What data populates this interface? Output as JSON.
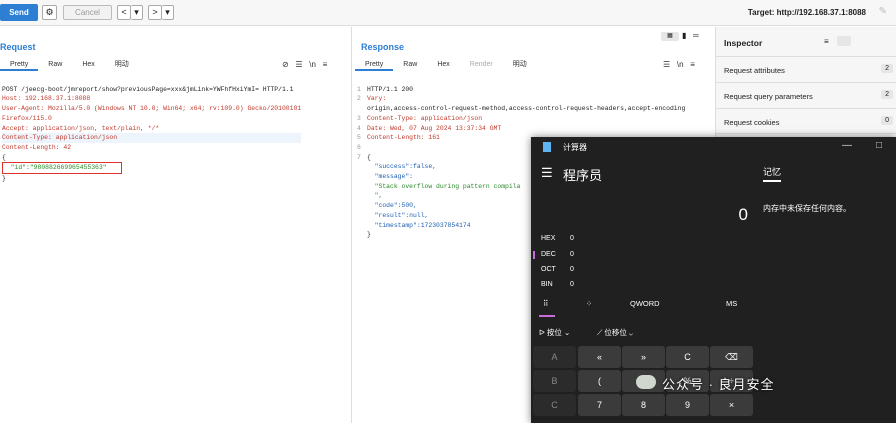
{
  "toolbar": {
    "send_label": "Send",
    "cancel_label": "Cancel",
    "back_label": "<",
    "back_dropdown": "▾",
    "forward_label": ">",
    "forward_dropdown": "▾",
    "target": "Target: http://192.168.37.1:8088"
  },
  "request": {
    "title": "Request",
    "tabs": [
      "Pretty",
      "Raw",
      "Hex",
      "明动"
    ],
    "lines": [
      "POST /jeecg-boot/jmreport/show?previousPage=xxx&jmLink=YWFhfHxiYmI= HTTP/1.1",
      "Host: 192.168.37.1:8088",
      "User-Agent: Mozilla/5.0 (Windows NT 10.0; Win64; x64; rv:109.0) Gecko/20100101",
      "Firefox/115.0",
      "Accept: application/json, text/plain, */*",
      "Content-Type: application/json",
      "Content-Length: 42",
      "",
      "{",
      "  \"id\":\"980882669965455363\"",
      "}"
    ]
  },
  "response": {
    "title": "Response",
    "tabs": [
      "Pretty",
      "Raw",
      "Hex",
      "Render",
      "明动"
    ],
    "lines": [
      "HTTP/1.1 200",
      "Vary:",
      "origin,access-control-request-method,access-control-request-headers,accept-encoding",
      "Content-Type: application/json",
      "Date: Wed, 07 Aug 2024 13:37:34 GMT",
      "Content-Length: 161",
      "",
      "{",
      "  \"success\":false,",
      "  \"message\":",
      "  \"Stack overflow during pattern compila",
      "  \",",
      "  \"code\":500,",
      "  \"result\":null,",
      "  \"timestamp\":1723037854174",
      "}"
    ],
    "line_numbers": [
      "1",
      "2",
      "",
      "3",
      "4",
      "5",
      "6",
      "7",
      "",
      "",
      "",
      "",
      "",
      "",
      "",
      ""
    ]
  },
  "inspector": {
    "title": "Inspector",
    "rows": [
      {
        "label": "Request attributes",
        "count": "2"
      },
      {
        "label": "Request query parameters",
        "count": "2"
      },
      {
        "label": "Request cookies",
        "count": "0"
      }
    ]
  },
  "calculator": {
    "window_title": "计算器",
    "mode": "程序员",
    "display": "0",
    "memory_title": "记忆",
    "memory_message": "内存中未保存任何内容。",
    "bases": [
      {
        "name": "HEX",
        "value": "0"
      },
      {
        "name": "DEC",
        "value": "0"
      },
      {
        "name": "OCT",
        "value": "0"
      },
      {
        "name": "BIN",
        "value": "0"
      }
    ],
    "word_size": "QWORD",
    "ms_label": "MS",
    "bitwise_label": "按位",
    "shift_label": "位移位",
    "keys": [
      "A",
      "«",
      "»",
      "C",
      "⌫",
      "B",
      "(",
      ")",
      "%",
      "÷",
      "C",
      "7",
      "8",
      "9",
      "×"
    ]
  },
  "watermark": "公众号 · 良月安全"
}
